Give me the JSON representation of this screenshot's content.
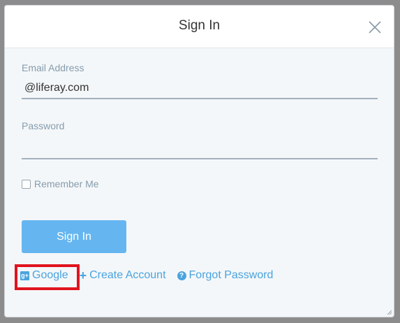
{
  "dialog": {
    "title": "Sign In"
  },
  "form": {
    "email": {
      "label": "Email Address",
      "value": "@liferay.com"
    },
    "password": {
      "label": "Password",
      "value": ""
    },
    "remember_me": {
      "label": "Remember Me",
      "checked": false
    },
    "submit_label": "Sign In"
  },
  "links": {
    "google": "Google",
    "create_account": "Create Account",
    "forgot_password": "Forgot Password"
  },
  "icons": {
    "close": "close-icon",
    "google": "google-plus-icon",
    "create": "plus-icon",
    "forgot": "question-circle-icon"
  },
  "colors": {
    "accent": "#4aa3df",
    "button": "#65b6f0",
    "highlight": "#e0141e"
  }
}
